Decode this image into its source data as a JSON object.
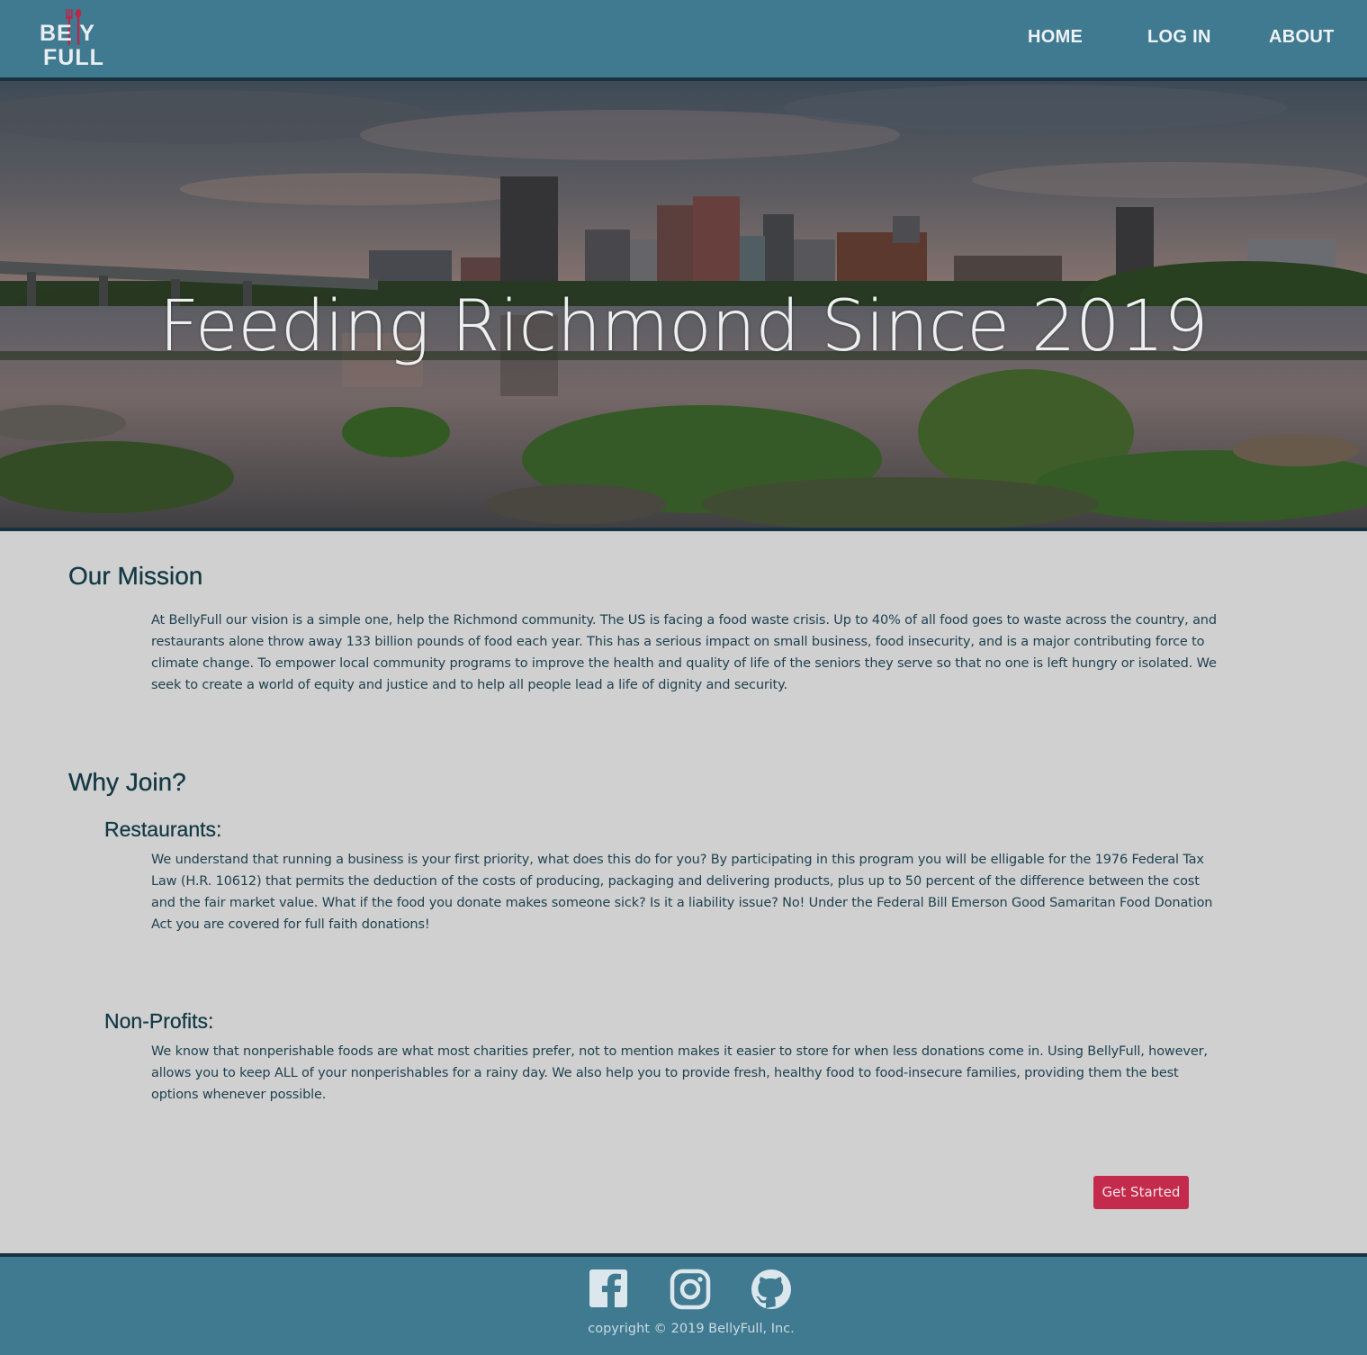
{
  "brand": {
    "logo_line1": "BE  Y",
    "logo_line2": "FULL",
    "name": "BellyFull"
  },
  "nav": {
    "home": "HOME",
    "login": "LOG IN",
    "about": "ABOUT"
  },
  "hero": {
    "title": "Feeding Richmond Since 2019"
  },
  "mission": {
    "heading": "Our Mission",
    "body": "At BellyFull our vision is a simple one, help the Richmond community. The US is facing a food waste crisis. Up to 40% of all food goes to waste across the country, and restaurants alone throw away 133 billion pounds of food each year. This has a serious impact on small business, food insecurity, and is a major contributing force to climate change. To empower local community programs to improve the health and quality of life of the seniors they serve so that no one is left hungry or isolated. We seek to create a world of equity and justice and to help all people lead a life of dignity and security."
  },
  "why_join": {
    "heading": "Why Join?",
    "restaurants": {
      "heading": "Restaurants:",
      "body": "We understand that running a business is your first priority, what does this do for you? By participating in this program you will be elligable for the 1976 Federal Tax Law (H.R. 10612) that permits the deduction of the costs of producing, packaging and delivering products, plus up to 50 percent of the difference between the cost and the fair market value. What if the food you donate makes someone sick? Is it a liability issue? No! Under the Federal Bill Emerson Good Samaritan Food Donation Act you are covered for full faith donations!"
    },
    "nonprofits": {
      "heading": "Non-Profits:",
      "body": "We know that nonperishable foods are what most charities prefer, not to mention makes it easier to store for when less donations come in. Using BellyFull, however, allows you to keep ALL of your nonperishables for a rainy day. We also help you to provide fresh, healthy food to food-insecure families, providing them the best options whenever possible."
    }
  },
  "cta": {
    "label": "Get Started"
  },
  "footer": {
    "icons": [
      "facebook-icon",
      "instagram-icon",
      "github-icon"
    ],
    "copyright": "copyright © 2019 BellyFull, Inc."
  },
  "colors": {
    "header_bg": "#3f7a91",
    "border_dark": "#183340",
    "page_bg": "#d0d0d0",
    "heading": "#123944",
    "cta": "#c42a4b",
    "logo_accent": "#b8284a"
  }
}
